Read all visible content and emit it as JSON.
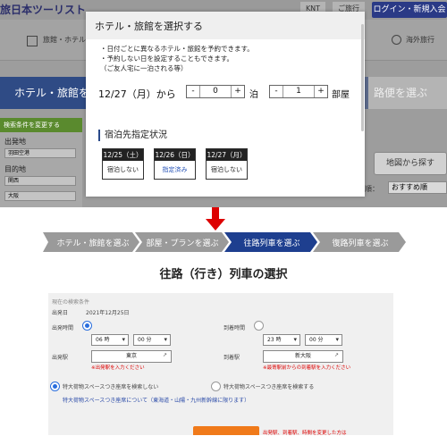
{
  "site": {
    "logo": "旅日本ツーリスト",
    "badges": [
      "KNT",
      "ご旅行"
    ],
    "login_label": "ログイン・新規入会",
    "nav": {
      "hotels": "旅館・ホテル",
      "overseas": "海外旅行"
    },
    "steps_top": {
      "hotel": "ホテル・旅館を選ぶ",
      "outbound_partial": "路便を選ぶ"
    },
    "side": {
      "head": "検索条件を変更する",
      "departure_label": "出発地",
      "departure_value": "羽田空港",
      "destination_label": "目的地",
      "destination_value": "関西",
      "city_value": "大阪"
    },
    "map_button": "地図から探す",
    "sort_label": "び順：",
    "sort_value": "おすすめ順"
  },
  "modal": {
    "title": "ホテル・旅館を選択する",
    "notes": [
      "・日付ごとに異なるホテル・旅館を予約できます。",
      "・予約しない日を設定することもできます。",
      "（ご友人宅に一泊される等）"
    ],
    "date_text": "12/27（月）から",
    "nights": {
      "minus": "-",
      "value": "0",
      "plus": "+",
      "unit": "泊"
    },
    "rooms": {
      "minus": "-",
      "value": "1",
      "plus": "+",
      "unit": "部屋"
    },
    "section_title": "宿泊先指定状況",
    "cards": [
      {
        "date": "12/25（土）",
        "status": "宿泊しない",
        "booked": false
      },
      {
        "date": "12/26（日）",
        "status": "指定済み",
        "booked": true
      },
      {
        "date": "12/27（月）",
        "status": "宿泊しない",
        "booked": false
      }
    ]
  },
  "bottom": {
    "steps": [
      {
        "label": "ホテル・旅館を選ぶ",
        "active": false
      },
      {
        "label": "部屋・プランを選ぶ",
        "active": false
      },
      {
        "label": "往路列車を選ぶ",
        "active": true
      },
      {
        "label": "復路列車を選ぶ",
        "active": false
      }
    ],
    "title": "往路（行き）列車の選択",
    "form": {
      "heading": "現在の検索条件",
      "date_label": "出発日",
      "date_value": "2021年12月25日",
      "dep_time_label": "出発時間",
      "dep_hour": "06 時",
      "dep_min": "00 分",
      "arr_time_label": "到着時間",
      "arr_hour": "23 時",
      "arr_min": "00 分",
      "dep_station_label": "出発駅",
      "dep_station": "東京",
      "arr_station_label": "到着駅",
      "arr_station": "新大阪",
      "dep_note": "※出発駅を入力ください",
      "arr_note": "※最寄駅前からの到着駅を入力ください",
      "opt_no_luggage": "特大荷物スペースつき座席を検索しない",
      "opt_luggage": "特大荷物スペースつき座席を検索する",
      "luggage_link": "特大荷物スペースつき座席について（東海道・山陽・九州新幹線に限ります）",
      "bottom_note": "出発駅、到着駅、時間を変更した方は"
    }
  },
  "colors": {
    "accent_blue": "#2a4a8a",
    "step_active": "#1e3f8f",
    "step_inactive": "#9a9a9a",
    "arrow_red": "#dd0000",
    "search_button": "#f07a1a"
  }
}
